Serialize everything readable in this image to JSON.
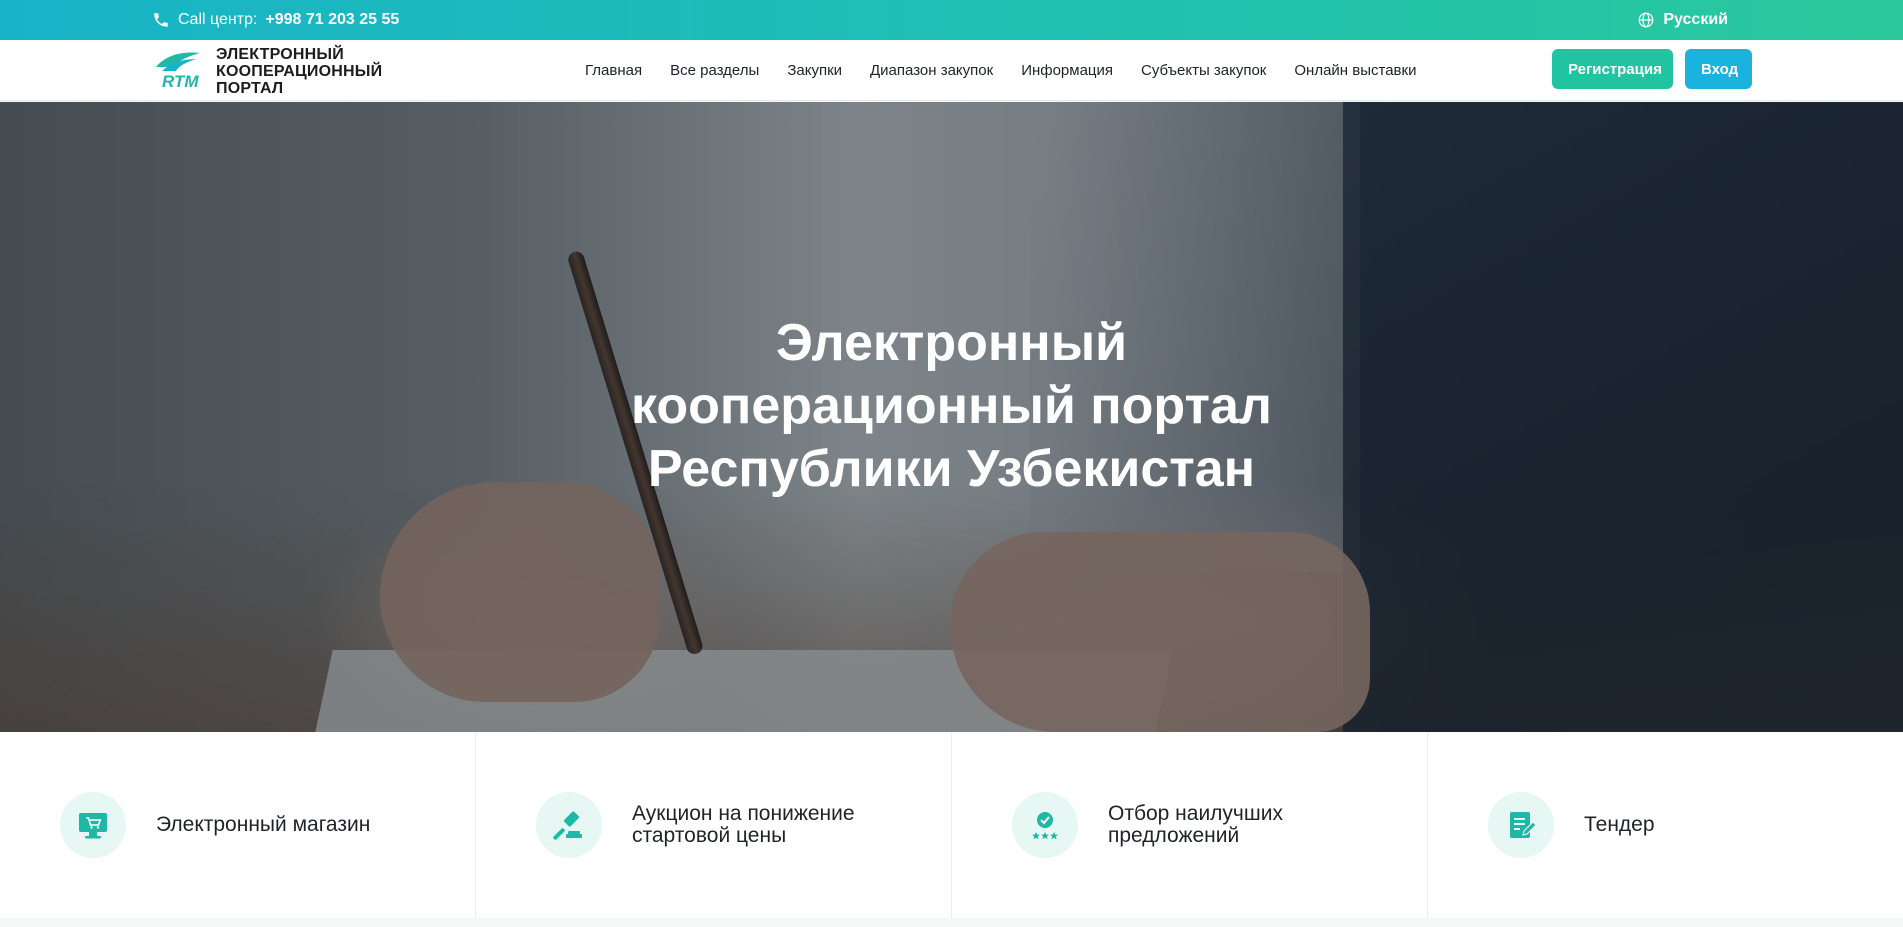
{
  "topbar": {
    "call_label": "Call центр:",
    "call_number": "+998 71 203 25 55",
    "language": "Русский",
    "icons": {
      "phone": "phone-icon",
      "language": "globe-icon"
    }
  },
  "navbar": {
    "logo_mark": "RTM",
    "brand_lines": [
      "ЭЛЕКТРОННЫЙ",
      "КООПЕРАЦИОННЫЙ",
      "ПОРТАЛ"
    ],
    "menu": [
      {
        "label": "Главная"
      },
      {
        "label": "Все разделы"
      },
      {
        "label": "Закупки"
      },
      {
        "label": "Диапазон закупок"
      },
      {
        "label": "Информация"
      },
      {
        "label": "Субъекты закупок"
      },
      {
        "label": "Онлайн выставки"
      }
    ],
    "register_label": "Регистрация",
    "login_label": "Вход"
  },
  "hero": {
    "title_lines": [
      "Электронный",
      "кооперационный портал",
      "Республики Узбекистан"
    ]
  },
  "categories": [
    {
      "label": "Электронный магазин",
      "icon": "shop-cart-icon"
    },
    {
      "label": "Аукцион на понижение стартовой цены",
      "icon": "gavel-icon"
    },
    {
      "label": "Отбор наилучших предложений",
      "icon": "badge-stars-icon"
    },
    {
      "label": "Тендер",
      "icon": "document-edit-icon"
    }
  ],
  "colors": {
    "topbar_gradient_start": "#19b3c8",
    "topbar_gradient_end": "#2ac89c",
    "register_button": "#22c3a0",
    "login_button": "#19b3de",
    "icon_circle": "#e6f7f4",
    "icon_accent": "#1fb8a6"
  }
}
